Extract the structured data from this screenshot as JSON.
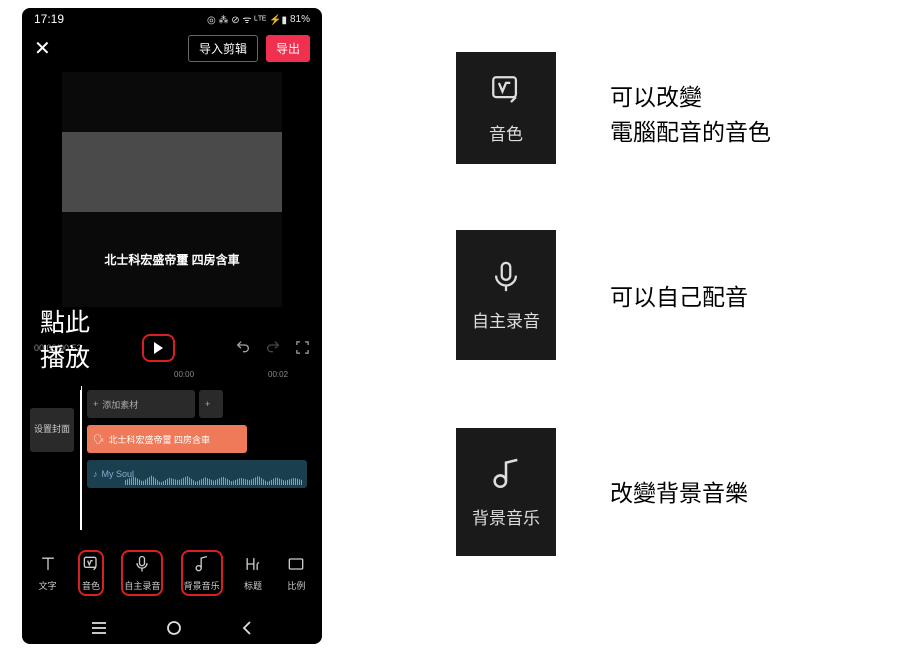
{
  "status": {
    "time": "17:19",
    "battery": "81%",
    "icons": "◎ ⁂ ⊘ ᯤ ᴸᵀᴱ ⚡▮"
  },
  "topBar": {
    "import": "导入剪辑",
    "export": "导出"
  },
  "preview": {
    "caption": "北士科宏盛帝璽 四房含車"
  },
  "annotation": {
    "line1": "點此",
    "line2": "播放"
  },
  "playback": {
    "timecode": "00:00/00:52"
  },
  "ruler": {
    "t1": "00:00",
    "t2": "00:02"
  },
  "timeline": {
    "cover": "设置封面",
    "addClip": "添加素材",
    "voiceTrack": "北士科宏盛帝璽 四房含車",
    "musicTrack": "My Soul"
  },
  "toolbar": {
    "text": "文字",
    "voice": "音色",
    "record": "自主录音",
    "bgm": "背景音乐",
    "title": "标题",
    "ratio": "比例"
  },
  "cards": {
    "voice": {
      "label": "音色",
      "desc": "可以改變\n電腦配音的音色"
    },
    "record": {
      "label": "自主录音",
      "desc": "可以自己配音"
    },
    "bgm": {
      "label": "背景音乐",
      "desc": "改變背景音樂"
    }
  }
}
